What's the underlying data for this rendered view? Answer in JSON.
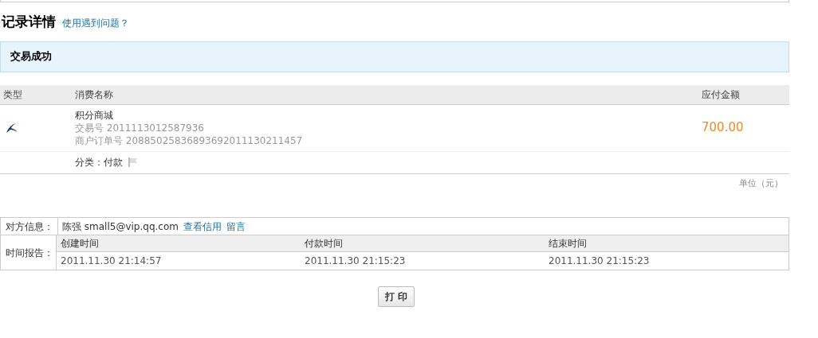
{
  "title": "记录详情",
  "help_link": "使用遇到问题？",
  "status": "交易成功",
  "table": {
    "columns": [
      "类型",
      "消费名称",
      "应付金额"
    ],
    "row": {
      "name": "积分商城",
      "trade_no_label": "交易号",
      "trade_no": "2011113012587936",
      "order_no_label": "商户订单号",
      "order_no": "20885025836893692011130211457",
      "amount": "700.00",
      "category": "分类：付款"
    }
  },
  "unit": "单位（元）",
  "info": {
    "counterparty_label": "对方信息：",
    "counterparty_name": "陈强",
    "counterparty_email": "small5@vip.qq.com",
    "links": [
      "查看信用",
      "留言"
    ],
    "time_label": "时间报告：",
    "times": [
      {
        "label": "创建时间",
        "value": "2011.11.30 21:14:57"
      },
      {
        "label": "付款时间",
        "value": "2011.11.30 21:15:23"
      },
      {
        "label": "结束时间",
        "value": "2011.11.30 21:15:23"
      }
    ]
  },
  "print_button": "打 印"
}
